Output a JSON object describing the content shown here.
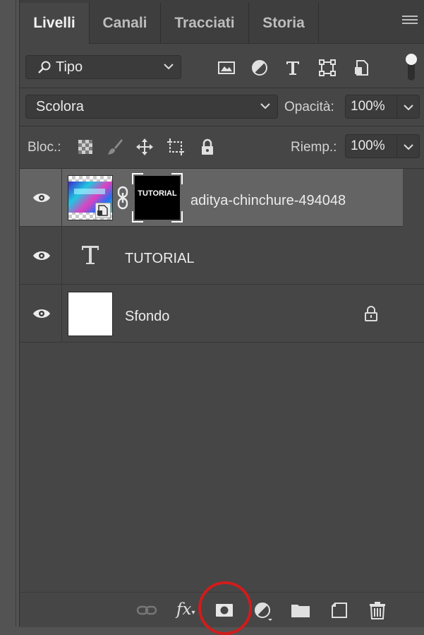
{
  "tabs": [
    {
      "label": "Livelli",
      "active": true
    },
    {
      "label": "Canali",
      "active": false
    },
    {
      "label": "Tracciati",
      "active": false
    },
    {
      "label": "Storia",
      "active": false
    }
  ],
  "filter": {
    "kind_label": "Tipo",
    "filter_icons": [
      "image-filter-icon",
      "adjustment-filter-icon",
      "type-filter-icon",
      "shape-filter-icon",
      "smart-object-filter-icon"
    ]
  },
  "blend": {
    "mode": "Scolora",
    "opacity_label": "Opacità:",
    "opacity_value": "100%"
  },
  "lock": {
    "label": "Bloc.:",
    "fill_label": "Riemp.:",
    "fill_value": "100%",
    "lock_icons": [
      "lock-transparent-icon",
      "lock-image-icon",
      "lock-position-icon",
      "lock-artboard-icon",
      "lock-all-icon"
    ]
  },
  "layers": [
    {
      "name": "aditya-chinchure-494048",
      "type": "smart-object",
      "selected": true,
      "mask_text": "TUTORIAL"
    },
    {
      "name": "TUTORIAL",
      "type": "text",
      "selected": false
    },
    {
      "name": "Sfondo",
      "type": "background",
      "selected": false,
      "locked": true
    }
  ],
  "bottom_icons": [
    "link-layers-icon",
    "fx-icon",
    "add-mask-icon",
    "adjustment-layer-icon",
    "group-folder-icon",
    "new-layer-icon",
    "trash-icon"
  ],
  "fx_label": "fx",
  "colors": {
    "panel": "#464646",
    "selected_row": "#646464",
    "highlight": "#d01c1c"
  }
}
